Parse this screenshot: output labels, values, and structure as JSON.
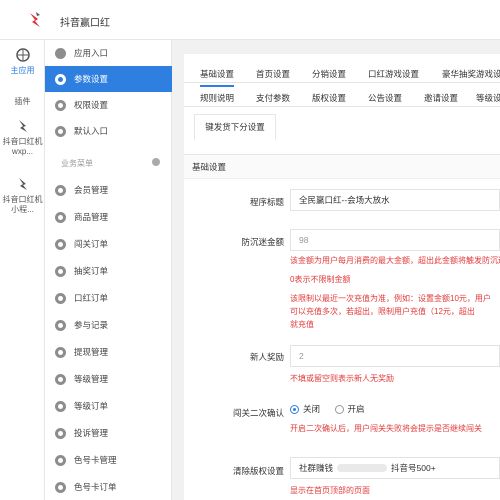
{
  "app": {
    "title": "抖音赢口红"
  },
  "rail": {
    "items": [
      {
        "label": "主应用",
        "active": true
      },
      {
        "label": "插件"
      },
      {
        "label": "抖音口红机wxp..."
      },
      {
        "label": "抖音口红机小程..."
      }
    ]
  },
  "sidebar": {
    "items": [
      {
        "label": "应用入口",
        "icon": "chat-icon"
      },
      {
        "label": "参数设置",
        "icon": "gear-icon",
        "active": true
      },
      {
        "label": "权限设置",
        "icon": "gear-icon"
      },
      {
        "label": "默认入口",
        "icon": "gear-icon"
      }
    ],
    "section_label": "业务菜单",
    "business_items": [
      {
        "label": "会员管理"
      },
      {
        "label": "商品管理"
      },
      {
        "label": "闯关订单"
      },
      {
        "label": "抽奖订单"
      },
      {
        "label": "口红订单"
      },
      {
        "label": "参与记录"
      },
      {
        "label": "提现管理"
      },
      {
        "label": "等级管理"
      },
      {
        "label": "等级订单"
      },
      {
        "label": "投诉管理"
      },
      {
        "label": "色号卡管理"
      },
      {
        "label": "色号卡订单"
      }
    ]
  },
  "tabs": {
    "row1": [
      "基础设置",
      "首页设置",
      "分销设置",
      "口红游戏设置",
      "豪华抽奖游戏设置"
    ],
    "row2": [
      "规则说明",
      "支付参数",
      "版权设置",
      "公告设置",
      "邀请设置",
      "等级设置"
    ],
    "sub": "键发货下分设置"
  },
  "form": {
    "heading": "基础设置",
    "fields": {
      "program_title": {
        "label": "程序标题",
        "value": "全民赢口红--会场大放水"
      },
      "withdraw_amount": {
        "label": "防沉迷金额",
        "value": "98",
        "help1": "该金额为用户每月消费的最大金额，超出此金额将触发防沉迷",
        "help2": "0表示不限制金额",
        "help3": "该限制以最近一次充值为准，例如：设置金额10元，用户",
        "help4": "可以充值多次，若超出，限制用户充值（12元，超出",
        "help5": "就充值"
      },
      "new_user": {
        "label": "新人奖励",
        "value": "2",
        "help": "不填或留空则表示新人无奖励"
      },
      "second_confirm": {
        "label": "闯关二次确认",
        "option_off": "关闭",
        "option_on": "开启",
        "help": "开启二次确认后，用户闯关失败将会提示是否继续闯关"
      },
      "claim_setting": {
        "label": "清除版权设置",
        "value": "社群赚钱",
        "value2": "抖音号500+",
        "help": "显示在首页顶部的页面"
      }
    }
  },
  "colors": {
    "accent": "#2f7fe0",
    "danger": "#e23a3a"
  }
}
